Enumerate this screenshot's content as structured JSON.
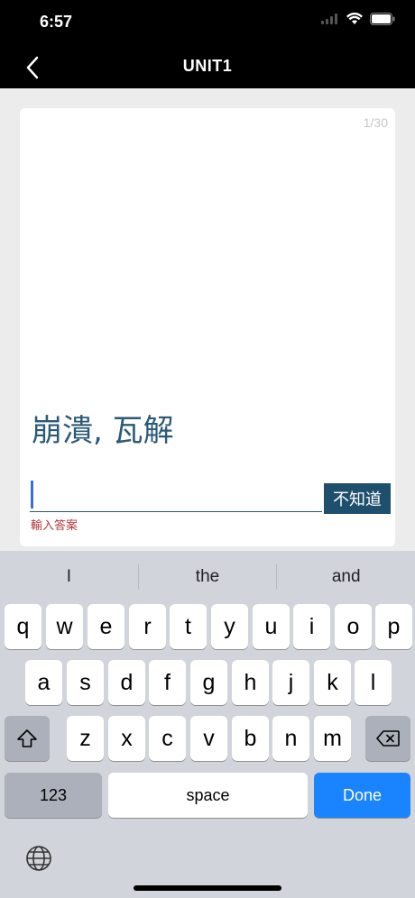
{
  "status": {
    "time": "6:57"
  },
  "nav": {
    "title": "UNIT1"
  },
  "card": {
    "counter": "1/30",
    "question": "崩潰, 瓦解",
    "input_value": "",
    "dont_know_label": "不知道",
    "hint": "輸入答案"
  },
  "keyboard": {
    "suggestions": [
      "I",
      "the",
      "and"
    ],
    "row1": [
      "q",
      "w",
      "e",
      "r",
      "t",
      "y",
      "u",
      "i",
      "o",
      "p"
    ],
    "row2": [
      "a",
      "s",
      "d",
      "f",
      "g",
      "h",
      "j",
      "k",
      "l"
    ],
    "row3": [
      "z",
      "x",
      "c",
      "v",
      "b",
      "n",
      "m"
    ],
    "numbers_label": "123",
    "space_label": "space",
    "done_label": "Done"
  },
  "colors": {
    "accent": "#1e4f6d",
    "done": "#1a84ff",
    "hint": "#b3383b"
  }
}
